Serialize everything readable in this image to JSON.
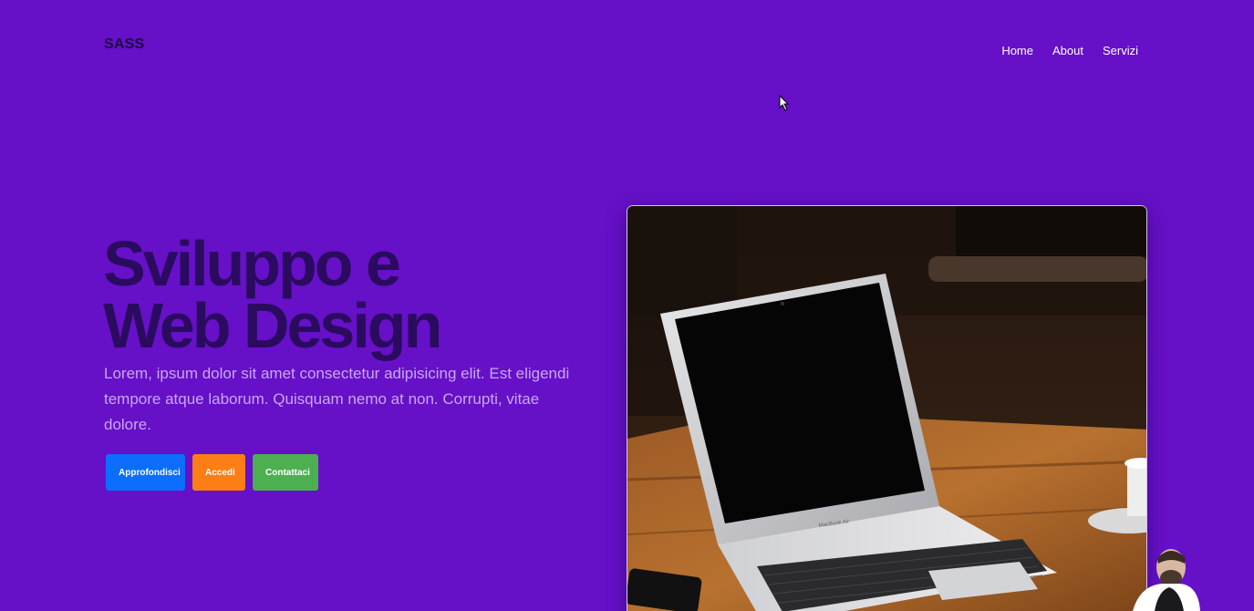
{
  "brand": {
    "logo": "SASS"
  },
  "nav": {
    "items": [
      {
        "label": "Home"
      },
      {
        "label": "About"
      },
      {
        "label": "Servizi"
      }
    ]
  },
  "hero": {
    "title_line1": "Sviluppo e",
    "title_line2": "Web Design",
    "text": "Lorem, ipsum dolor sit amet consectetur adipisicing elit. Est eligendi tempore atque laborum. Quisquam nemo at non. Corrupti, vitae dolore.",
    "buttons": {
      "primary": "Approfondisci",
      "warning": "Accedi",
      "success": "Contattaci"
    },
    "image_laptop_label": "MacBook Air"
  },
  "colors": {
    "background": "#6610c8",
    "title": "#2a0b5e",
    "btn_primary": "#0d6efd",
    "btn_warning": "#fd7e14",
    "btn_success": "#4caf50"
  },
  "icons": {
    "cursor": "mouse-pointer-icon"
  }
}
